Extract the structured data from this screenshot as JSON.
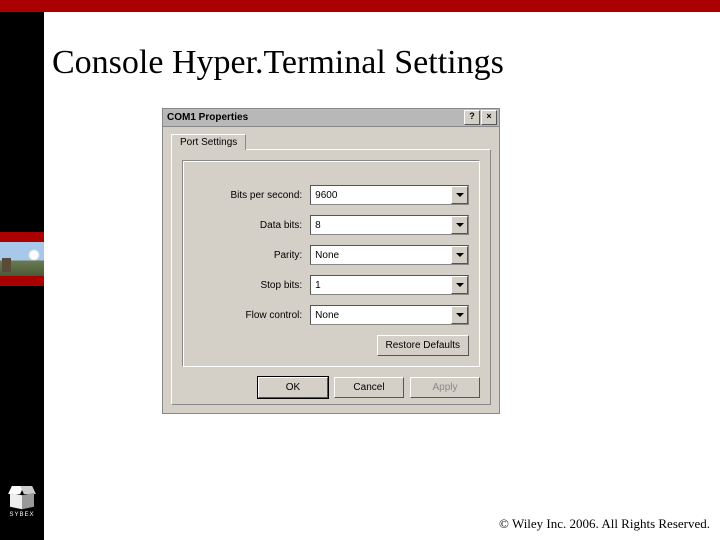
{
  "slide": {
    "title": "Console Hyper.Terminal Settings",
    "copyright": "© Wiley Inc. 2006. All Rights Reserved.",
    "logo_text": "SYBEX"
  },
  "dialog": {
    "title": "COM1 Properties",
    "help_btn": "?",
    "close_btn": "×",
    "tab": "Port Settings",
    "fields": {
      "bits_per_second": {
        "label": "Bits per second:",
        "value": "9600"
      },
      "data_bits": {
        "label": "Data bits:",
        "value": "8"
      },
      "parity": {
        "label": "Parity:",
        "value": "None"
      },
      "stop_bits": {
        "label": "Stop bits:",
        "value": "1"
      },
      "flow_control": {
        "label": "Flow control:",
        "value": "None"
      }
    },
    "buttons": {
      "restore": "Restore Defaults",
      "ok": "OK",
      "cancel": "Cancel",
      "apply": "Apply"
    }
  }
}
